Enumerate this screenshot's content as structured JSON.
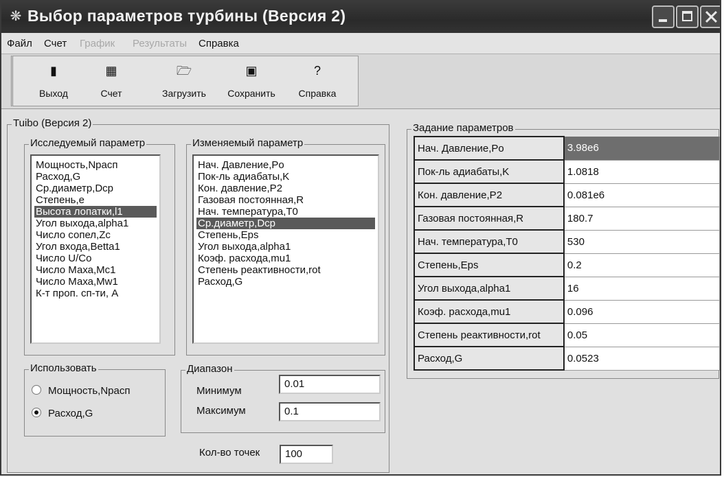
{
  "window": {
    "title": "Выбор параметров турбины (Версия 2)",
    "app_icon": "gear-icon",
    "controls": [
      "minimize-icon",
      "maximize-icon",
      "close-icon"
    ]
  },
  "menu": {
    "file": "Файл",
    "calc": "Счет",
    "graph": "График",
    "results": "Результаты",
    "help": "Справка"
  },
  "toolbar": {
    "exit": {
      "label": "Выход",
      "icon": "door-icon"
    },
    "calc": {
      "label": "Счет",
      "icon": "chart-icon"
    },
    "load": {
      "label": "Загрузить",
      "icon": "open-folder-icon"
    },
    "save": {
      "label": "Сохранить",
      "icon": "floppy-disk-icon"
    },
    "help": {
      "label": "Справка",
      "icon": "question-icon"
    }
  },
  "turbo_group": {
    "label": "Tuibo (Версия 2)",
    "studied": {
      "label": "Исследуемый параметр",
      "items": [
        "Мощность,Npacп",
        "Расход,G",
        "Ср.диаметр,Dcp",
        "Степень,e",
        "Высота лопатки,l1",
        "Угол выхода,alpha1",
        "Число сопел,Zc",
        "Угол входа,Betta1",
        "Число U/Co",
        "Число Маха,Mc1",
        "Число Маха,Mw1",
        "К-т проп. сп-ти, A"
      ],
      "selected": "Высота лопатки,l1"
    },
    "varied": {
      "label": "Изменяемый параметр",
      "items": [
        "Нач. Давление,Po",
        "Пок-ль адиабаты,K",
        "Кон. давление,P2",
        "Газовая постоянная,R",
        "Нач. температура,T0",
        "Ср.диаметр,Dcp",
        "Степень,Eps",
        "Угол выхода,alpha1",
        "Коэф. расхода,mu1",
        "Степень реактивности,rot",
        "Расход,G"
      ],
      "selected": "Ср.диаметр,Dcp"
    },
    "use": {
      "label": "Использовать",
      "option1": "Мощность,Npacп",
      "option2": "Расход,G",
      "selected": "Расход,G"
    },
    "range": {
      "label": "Диапазон",
      "min_label": "Минимум",
      "min_value": "0.01",
      "max_label": "Максимум",
      "max_value": "0.1"
    },
    "points_label": "Кол-во точек",
    "points_value": "100"
  },
  "params": {
    "label": "Задание параметров",
    "rows": [
      {
        "name": "Нач. Давление,Po",
        "value": "3.98e6"
      },
      {
        "name": "Пок-ль адиабаты,K",
        "value": "1.0818"
      },
      {
        "name": "Кон. давление,P2",
        "value": "0.081e6"
      },
      {
        "name": "Газовая постоянная,R",
        "value": "180.7"
      },
      {
        "name": "Нач. температура,T0",
        "value": "530"
      },
      {
        "name": "Степень,Eps",
        "value": "0.2"
      },
      {
        "name": "Угол выхода,alpha1",
        "value": "16"
      },
      {
        "name": "Коэф. расхода,mu1",
        "value": "0.096"
      },
      {
        "name": "Степень реактивности,rot",
        "value": "0.05"
      },
      {
        "name": "Расход,G",
        "value": "0.0523"
      }
    ],
    "active_row": "Нач. Давление,Po"
  }
}
